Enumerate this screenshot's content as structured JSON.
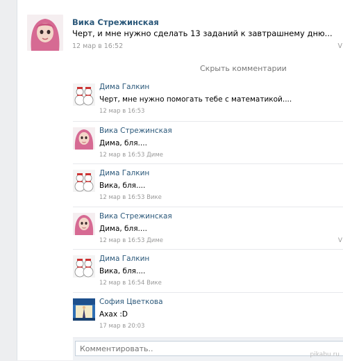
{
  "post": {
    "author": "Вика Стрежинская",
    "text": "Черт, и мне нужно сделать 13 заданий к завтрашнему дню...",
    "date": "12 мар в 16:52",
    "mark": "V"
  },
  "hide_comments_label": "Скрыть комментарии",
  "comments": [
    {
      "author": "Дима Галкин",
      "text": "Черт, мне нужно помогать тебе с математикой....",
      "date": "12 мар в 16:53",
      "addressee": "",
      "avatar": "snowman-avatar"
    },
    {
      "author": "Вика Стрежинская",
      "text": "Дима, бля....",
      "date": "12 мар в 16:53",
      "addressee": "Диме",
      "avatar": "girl-avatar"
    },
    {
      "author": "Дима Галкин",
      "text": "Вика, бля....",
      "date": "12 мар в 16:53",
      "addressee": "Вике",
      "avatar": "snowman-avatar"
    },
    {
      "author": "Вика Стрежинская",
      "text": "Дима, бля....",
      "date": "12 мар в 16:53",
      "addressee": "Диме",
      "avatar": "girl-avatar",
      "mark": "V"
    },
    {
      "author": "Дима Галкин",
      "text": "Вика, бля....",
      "date": "12 мар в 16:54",
      "addressee": "Вике",
      "avatar": "snowman-avatar"
    },
    {
      "author": "София Цветкова",
      "text": "Ахах :D",
      "date": "17 мар в 20:03",
      "addressee": "",
      "avatar": "sofia-avatar"
    }
  ],
  "comment_input": {
    "placeholder": "Комментировать.."
  },
  "watermark": "pikabu.ru",
  "colors": {
    "link": "#2b587a",
    "muted": "#999999",
    "background": "#edeef0"
  }
}
